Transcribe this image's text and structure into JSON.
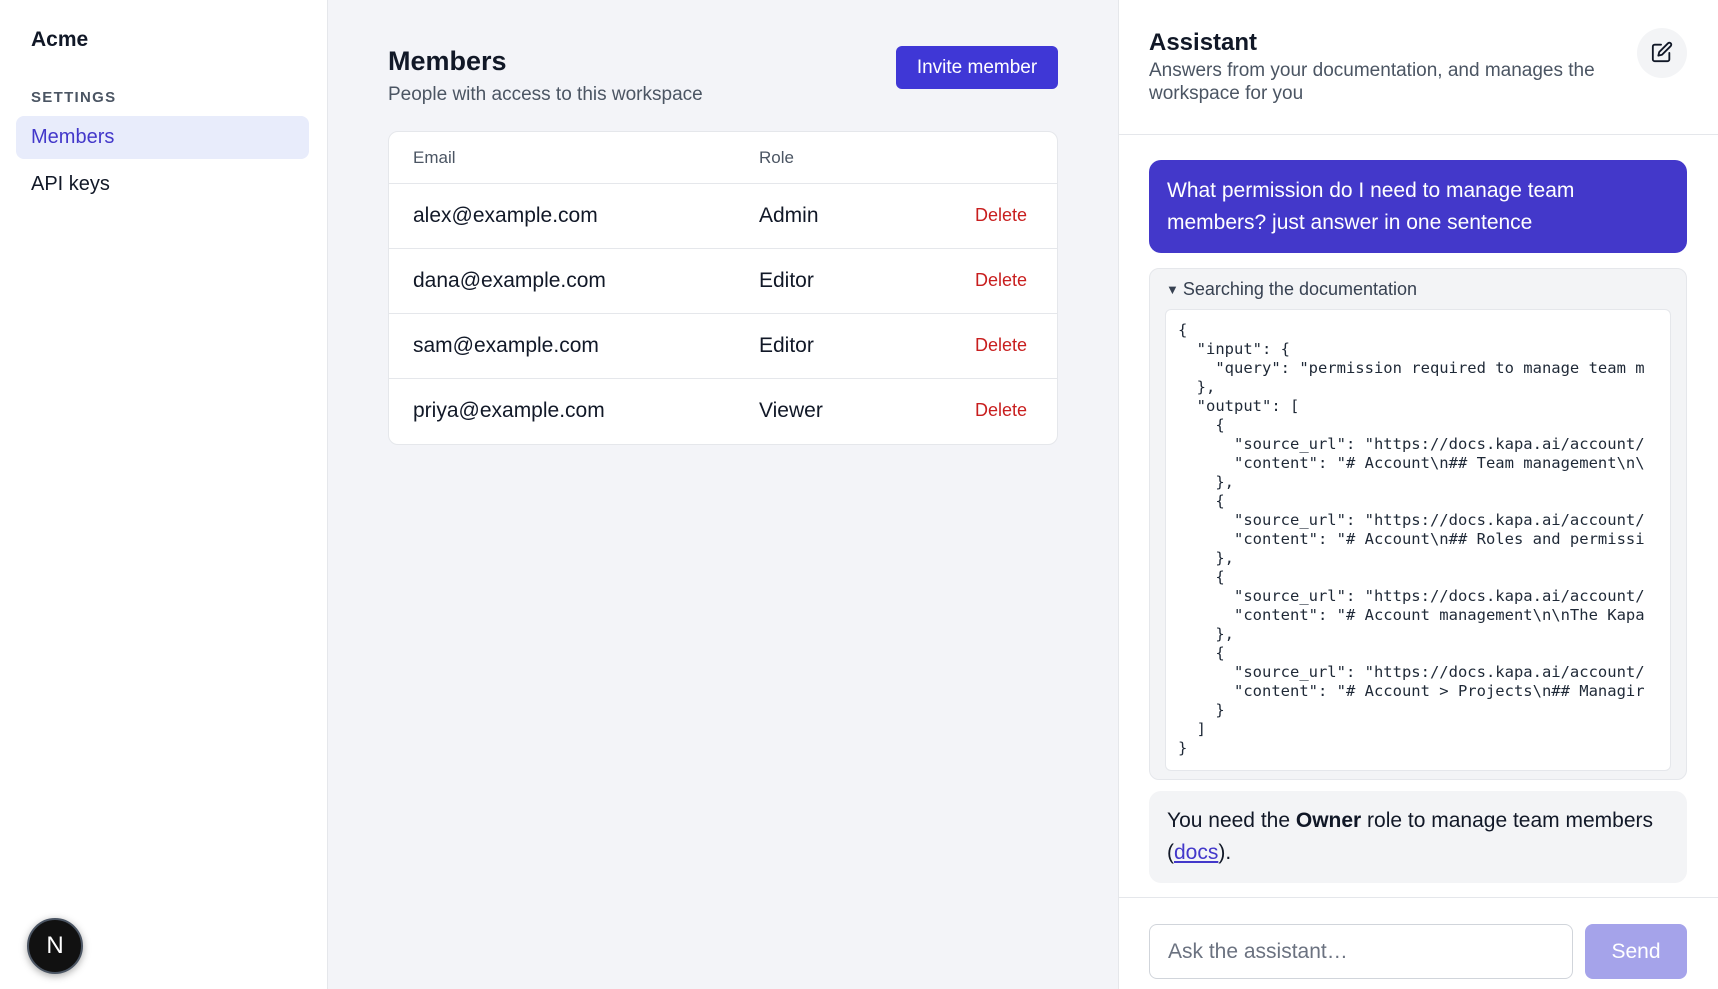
{
  "sidebar": {
    "brand": "Acme",
    "section_label": "SETTINGS",
    "items": [
      {
        "label": "Members",
        "active": true
      },
      {
        "label": "API keys",
        "active": false
      }
    ],
    "badge_letter": "N"
  },
  "main": {
    "title": "Members",
    "subtitle": "People with access to this workspace",
    "invite_label": "Invite member",
    "table": {
      "headers": [
        "Email",
        "Role"
      ],
      "rows": [
        {
          "email": "alex@example.com",
          "role": "Admin",
          "action": "Delete"
        },
        {
          "email": "dana@example.com",
          "role": "Editor",
          "action": "Delete"
        },
        {
          "email": "sam@example.com",
          "role": "Editor",
          "action": "Delete"
        },
        {
          "email": "priya@example.com",
          "role": "Viewer",
          "action": "Delete"
        }
      ]
    }
  },
  "assistant": {
    "title": "Assistant",
    "subtitle": "Answers from your documentation, and manages the workspace for you",
    "new_chat_icon": "compose-icon",
    "user_message": "What permission do I need to manage team members? just answer in one sentence",
    "tool_call": {
      "summary": "Searching the documentation",
      "code": "{\n  \"input\": {\n    \"query\": \"permission required to manage team m\n  },\n  \"output\": [\n    {\n      \"source_url\": \"https://docs.kapa.ai/account/\n      \"content\": \"# Account\\n## Team management\\n\\\n    },\n    {\n      \"source_url\": \"https://docs.kapa.ai/account/\n      \"content\": \"# Account\\n## Roles and permissi\n    },\n    {\n      \"source_url\": \"https://docs.kapa.ai/account/\n      \"content\": \"# Account management\\n\\nThe Kapa\n    },\n    {\n      \"source_url\": \"https://docs.kapa.ai/account/\n      \"content\": \"# Account > Projects\\n## Managir\n    }\n  ]\n}"
    },
    "answer": {
      "prefix": "You need the ",
      "bold": "Owner",
      "middle": " role to manage team members (",
      "link": "docs",
      "suffix": ")."
    },
    "composer": {
      "placeholder": "Ask the assistant…",
      "send_label": "Send"
    }
  },
  "colors": {
    "accent": "#4338ca",
    "danger": "#c81e1e",
    "send_disabled": "#a5a3ea"
  }
}
